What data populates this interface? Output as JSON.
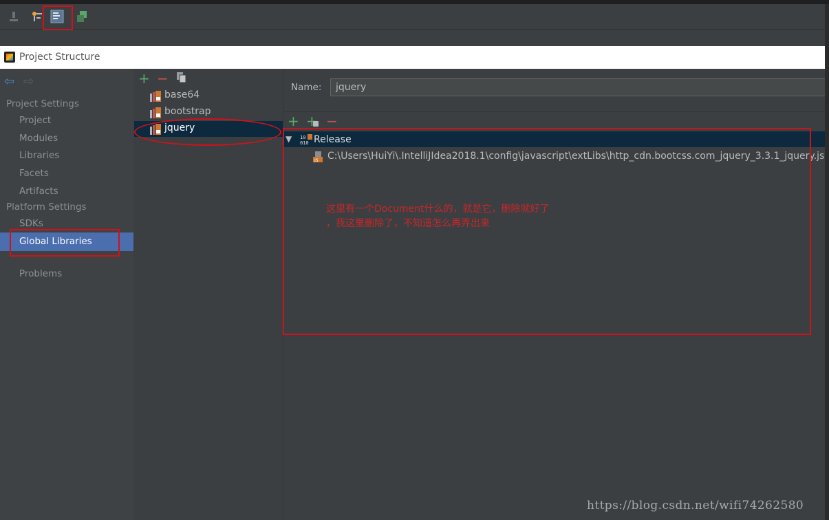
{
  "window": {
    "title": "Project Structure"
  },
  "toolbar": {
    "icons": [
      "download-icon",
      "structure-tool-icon",
      "project-structure-icon",
      "vcs-icon"
    ]
  },
  "nav": {
    "back_icon": "back-arrow-icon",
    "forward_icon": "forward-arrow-icon"
  },
  "sidebar": {
    "project_settings_header": "Project Settings",
    "items_project": [
      "Project",
      "Modules",
      "Libraries",
      "Facets",
      "Artifacts"
    ],
    "platform_settings_header": "Platform Settings",
    "items_platform": [
      "SDKs",
      "Global Libraries"
    ],
    "selected": "Global Libraries",
    "problems": "Problems"
  },
  "libraries": {
    "toolbar_icons": [
      "add-icon",
      "remove-icon",
      "copy-icon"
    ],
    "items": [
      "base64",
      "bootstrap",
      "jquery"
    ],
    "selected": "jquery"
  },
  "detail": {
    "name_label": "Name:",
    "name_value": "jquery",
    "toolbar_icons": [
      "add-icon",
      "add-attach-icon",
      "remove-icon"
    ],
    "tree": {
      "root": "Release",
      "child": "C:\\Users\\HuiYi\\.IntelliJIdea2018.1\\config\\javascript\\extLibs\\http_cdn.bootcss.com_jquery_3.3.1_jquery.js"
    }
  },
  "annotation": {
    "line1": "这里有一个Document什么的，就是它，删除就好了",
    "line2": "，我这里删除了，不知道怎么再弄出来",
    "color": "#d0121b"
  },
  "watermark": "https://blog.csdn.net/wifi74262580",
  "colors": {
    "background": "#3c3f41",
    "selection": "#4b6eaf",
    "tree_selection": "#0d293e",
    "add_green": "#59a869",
    "remove_red": "#c75450"
  }
}
